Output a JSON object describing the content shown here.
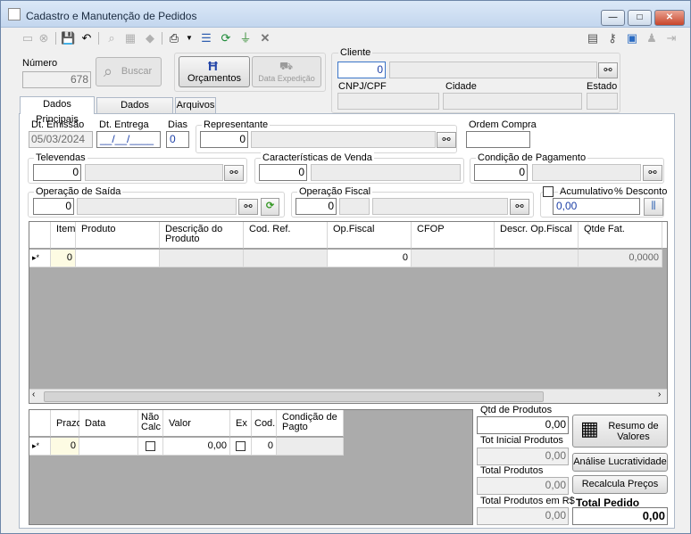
{
  "window": {
    "title": "Cadastro e Manutenção de Pedidos",
    "min": "—",
    "max": "□",
    "close": "✕"
  },
  "header": {
    "numero_label": "Número",
    "numero": "678",
    "buscar": "Buscar",
    "orcamentos": "Orçamentos",
    "data_expedicao": "Data Expedição",
    "cliente_label": "Cliente",
    "cliente_code": "0",
    "cnpj_label": "CNPJ/CPF",
    "cidade_label": "Cidade",
    "estado_label": "Estado"
  },
  "tabs": [
    {
      "label": "Dados Principais"
    },
    {
      "label": "Dados Adicionais"
    },
    {
      "label": "Arquivos"
    }
  ],
  "form": {
    "dt_emissao_label": "Dt. Emissão",
    "dt_emissao": "05/03/2024",
    "dt_entrega_label": "Dt. Entrega",
    "dt_entrega": "__/__/____",
    "dias_label": "Dias",
    "dias": "0",
    "representante_label": "Representante",
    "representante": "0",
    "ordem_compra_label": "Ordem Compra",
    "televendas_label": "Televendas",
    "televendas": "0",
    "caract_label": "Características de Venda",
    "caract": "0",
    "cond_pag_label": "Condição de Pagamento",
    "cond_pag": "0",
    "op_saida_label": "Operação de Saída",
    "op_saida": "0",
    "op_fiscal_label": "Operação Fiscal",
    "op_fiscal": "0",
    "acumulativo_label": "Acumulativo",
    "desconto_label": "% Desconto",
    "desconto": "0,00"
  },
  "items_grid": {
    "headers": [
      "Item",
      "Produto",
      "Descrição do Produto",
      "Cod. Ref.",
      "Op.Fiscal",
      "CFOP",
      "Descr. Op.Fiscal",
      "Qtde Fat."
    ],
    "row": {
      "marker": "▸*",
      "item": "0",
      "op_fiscal": "0",
      "qtde": "0,0000"
    }
  },
  "pay_grid": {
    "headers": [
      "Prazo",
      "Data",
      "Não Calc",
      "Valor",
      "Ex",
      "Cod.",
      "Condição de Pagto"
    ],
    "row": {
      "marker": "▸*",
      "prazo": "0",
      "valor": "0,00",
      "cod": "0"
    }
  },
  "totals": {
    "qtd_label": "Qtd de Produtos",
    "qtd": "0,00",
    "tot_inicial_label": "Tot Inicial Produtos",
    "tot_inicial": "0,00",
    "total_prod_label": "Total Produtos",
    "total_prod": "0,00",
    "total_rs_label": "Total Produtos em R$",
    "total_rs": "0,00",
    "total_pedido_label": "Total Pedido",
    "total_pedido": "0,00",
    "resumo": "Resumo de Valores",
    "analise": "Análise Lucratividade",
    "recalcula": "Recalcula Preços"
  },
  "colors": {
    "accent": "#1c3fa6",
    "title_bg": "#c3d6ee"
  }
}
